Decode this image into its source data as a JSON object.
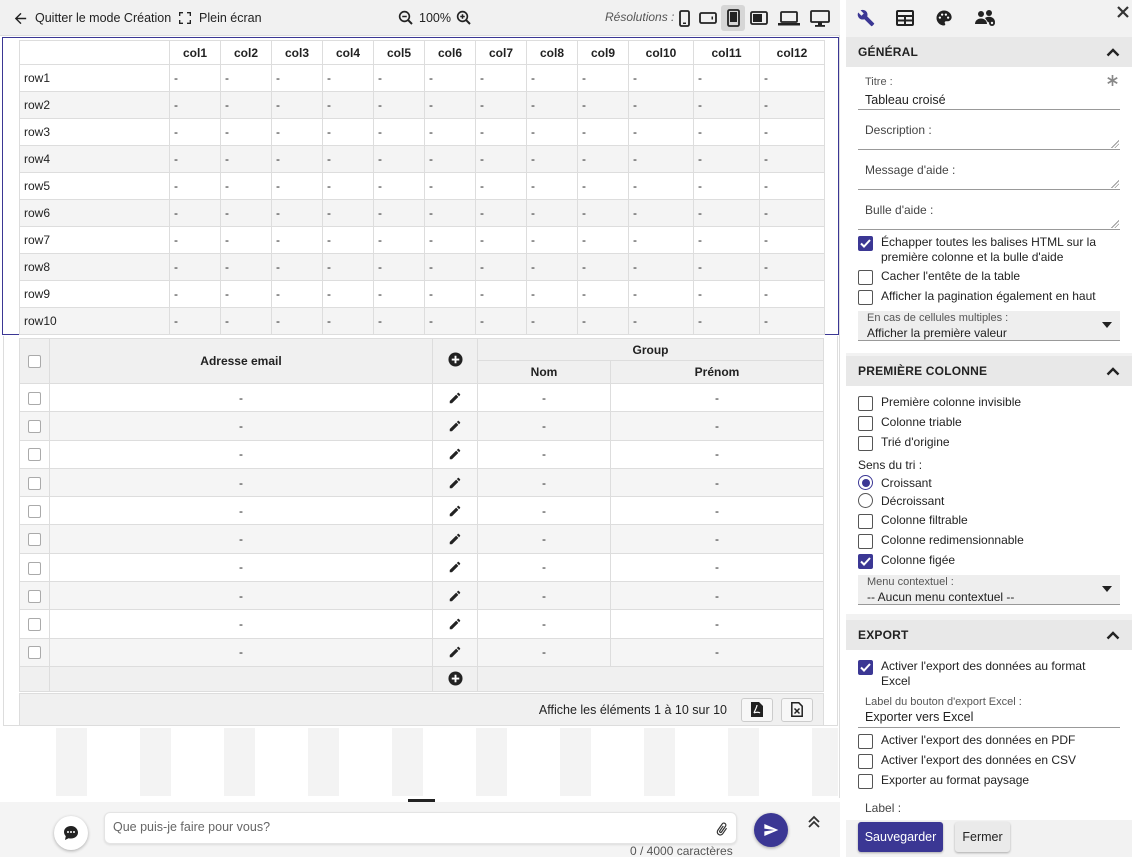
{
  "toolbar": {
    "quit_label": "Quitter le mode Création",
    "fullscreen_label": "Plein écran",
    "zoom": "100%",
    "resolutions_label": "Résolutions :"
  },
  "pivot": {
    "columns": [
      "col1",
      "col2",
      "col3",
      "col4",
      "col5",
      "col6",
      "col7",
      "col8",
      "col9",
      "col10",
      "col11",
      "col12"
    ],
    "rows": [
      "row1",
      "row2",
      "row3",
      "row4",
      "row5",
      "row6",
      "row7",
      "row8",
      "row9",
      "row10"
    ],
    "cell": "-"
  },
  "grid": {
    "col_email": "Adresse email",
    "group": "Group",
    "col_nom": "Nom",
    "col_prenom": "Prénom",
    "cell": "-",
    "row_count": 10,
    "footer_info": "Affiche les éléments 1 à 10 sur 10"
  },
  "chat": {
    "placeholder": "Que puis-je faire pour vous?",
    "counter": "0 / 4000 caractères"
  },
  "panel": {
    "general": {
      "title": "GÉNÉRAL",
      "titre_label": "Titre :",
      "titre_value": "Tableau croisé",
      "description_label": "Description :",
      "help_message_label": "Message d'aide :",
      "tooltip_label": "Bulle d'aide :",
      "escape_html": "Échapper toutes les balises HTML sur la première colonne et la bulle d'aide",
      "hide_header": "Cacher l'entête de la table",
      "pagination_top": "Afficher la pagination également en haut",
      "multi_cells_label": "En cas de cellules multiples :",
      "multi_cells_value": "Afficher la première valeur"
    },
    "first_column": {
      "title": "PREMIÈRE COLONNE",
      "invisible": "Première colonne invisible",
      "sortable": "Colonne triable",
      "original_sort": "Trié d'origine",
      "sort_direction_label": "Sens du tri :",
      "ascending": "Croissant",
      "descending": "Décroissant",
      "filterable": "Colonne filtrable",
      "resizable": "Colonne redimensionnable",
      "frozen": "Colonne figée",
      "context_menu_label": "Menu contextuel :",
      "context_menu_value": "-- Aucun menu contextuel --"
    },
    "export": {
      "title": "EXPORT",
      "excel": "Activer l'export des données au format Excel",
      "excel_button_label": "Label du bouton d'export Excel :",
      "excel_button_value": "Exporter vers Excel",
      "pdf": "Activer l'export des données en PDF",
      "csv": "Activer l'export des données en CSV",
      "landscape": "Exporter au format paysage",
      "label_field": "Label :"
    },
    "save": "Sauvegarder",
    "close": "Fermer"
  },
  "colors": {
    "accent": "#3b3794",
    "panel_bg": "#f2f2f2",
    "section_header_bg": "#e8e8e8"
  }
}
